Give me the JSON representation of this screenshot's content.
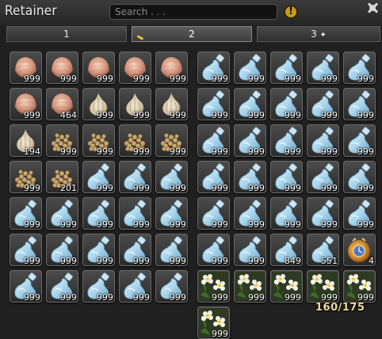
{
  "window": {
    "title": "Retainer",
    "search_placeholder": "Search . . .",
    "info_label": "!"
  },
  "tabs": [
    {
      "label": "1"
    },
    {
      "label": "2"
    },
    {
      "label": "3"
    }
  ],
  "left_grid": [
    {
      "item": "shell-icon",
      "qty": "999"
    },
    {
      "item": "shell-icon",
      "qty": "999"
    },
    {
      "item": "shell-icon",
      "qty": "999"
    },
    {
      "item": "shell-icon",
      "qty": "999"
    },
    {
      "item": "shell-icon",
      "qty": "999"
    },
    {
      "item": "shell-icon",
      "qty": "999"
    },
    {
      "item": "shell-icon",
      "qty": "464"
    },
    {
      "item": "garlic-icon",
      "qty": "999"
    },
    {
      "item": "garlic-icon",
      "qty": "999"
    },
    {
      "item": "garlic-icon",
      "qty": "999"
    },
    {
      "item": "garlic-icon",
      "qty": "194"
    },
    {
      "item": "seeds-icon",
      "qty": "999"
    },
    {
      "item": "seeds-icon",
      "qty": "999"
    },
    {
      "item": "seeds-icon",
      "qty": "999"
    },
    {
      "item": "seeds-icon",
      "qty": "999"
    },
    {
      "item": "seeds-icon",
      "qty": "999"
    },
    {
      "item": "seeds-icon",
      "qty": "201"
    },
    {
      "item": "water-bottle-icon",
      "qty": "999"
    },
    {
      "item": "water-bottle-icon",
      "qty": "999"
    },
    {
      "item": "water-bottle-icon",
      "qty": "999"
    },
    {
      "item": "water-bottle-icon",
      "qty": "999"
    },
    {
      "item": "water-bottle-icon",
      "qty": "999"
    },
    {
      "item": "water-bottle-icon",
      "qty": "999"
    },
    {
      "item": "water-bottle-icon",
      "qty": "999"
    },
    {
      "item": "water-bottle-icon",
      "qty": "999"
    },
    {
      "item": "water-bottle-icon",
      "qty": "999"
    },
    {
      "item": "water-bottle-icon",
      "qty": "999"
    },
    {
      "item": "water-bottle-icon",
      "qty": "999"
    },
    {
      "item": "water-bottle-icon",
      "qty": "999"
    },
    {
      "item": "water-bottle-icon",
      "qty": "999"
    },
    {
      "item": "water-bottle-icon",
      "qty": "999"
    },
    {
      "item": "water-bottle-icon",
      "qty": "999"
    },
    {
      "item": "water-bottle-icon",
      "qty": "999"
    },
    {
      "item": "water-bottle-icon",
      "qty": "999"
    },
    {
      "item": "water-bottle-icon",
      "qty": "999"
    }
  ],
  "right_grid": [
    {
      "item": "water-bottle-icon",
      "qty": "999"
    },
    {
      "item": "water-bottle-icon",
      "qty": "999"
    },
    {
      "item": "water-bottle-icon",
      "qty": "999"
    },
    {
      "item": "water-bottle-icon",
      "qty": "999"
    },
    {
      "item": "water-bottle-icon",
      "qty": "999"
    },
    {
      "item": "water-bottle-icon",
      "qty": "999"
    },
    {
      "item": "water-bottle-icon",
      "qty": "999"
    },
    {
      "item": "water-bottle-icon",
      "qty": "999"
    },
    {
      "item": "water-bottle-icon",
      "qty": "999"
    },
    {
      "item": "water-bottle-icon",
      "qty": "999"
    },
    {
      "item": "water-bottle-icon",
      "qty": "999"
    },
    {
      "item": "water-bottle-icon",
      "qty": "999"
    },
    {
      "item": "water-bottle-icon",
      "qty": "999"
    },
    {
      "item": "water-bottle-icon",
      "qty": "999"
    },
    {
      "item": "water-bottle-icon",
      "qty": "999"
    },
    {
      "item": "water-bottle-icon",
      "qty": "999"
    },
    {
      "item": "water-bottle-icon",
      "qty": "999"
    },
    {
      "item": "water-bottle-icon",
      "qty": "999"
    },
    {
      "item": "water-bottle-icon",
      "qty": "999"
    },
    {
      "item": "water-bottle-icon",
      "qty": "999"
    },
    {
      "item": "water-bottle-icon",
      "qty": "999"
    },
    {
      "item": "water-bottle-icon",
      "qty": "999"
    },
    {
      "item": "water-bottle-icon",
      "qty": "999"
    },
    {
      "item": "water-bottle-icon",
      "qty": "999"
    },
    {
      "item": "water-bottle-icon",
      "qty": "999"
    },
    {
      "item": "water-bottle-icon",
      "qty": "999"
    },
    {
      "item": "water-bottle-icon",
      "qty": "999"
    },
    {
      "item": "water-bottle-icon",
      "qty": "849"
    },
    {
      "item": "water-bottle-icon",
      "qty": "551"
    },
    {
      "item": "clock-orb-icon",
      "qty": "4"
    },
    {
      "item": "white-flower-icon",
      "qty": "999"
    },
    {
      "item": "white-flower-icon",
      "qty": "999"
    },
    {
      "item": "white-flower-icon",
      "qty": "999"
    },
    {
      "item": "white-flower-icon",
      "qty": "999"
    },
    {
      "item": "white-flower-icon",
      "qty": "999"
    },
    {
      "item": "white-flower-icon",
      "qty": "999"
    }
  ],
  "inventory_count": "160/175",
  "colors": {
    "accent": "#e8c23a",
    "count_text": "#f0d8a0",
    "slot_bg": "#3a3a3a"
  }
}
